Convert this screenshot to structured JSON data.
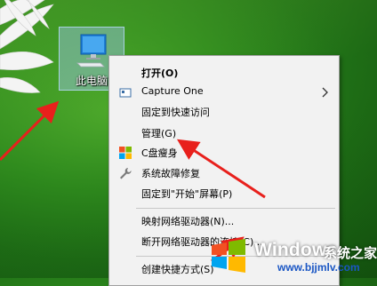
{
  "desktop": {
    "icon_label": "此电脑"
  },
  "context_menu": {
    "items": [
      {
        "label": "打开(O)",
        "bold": true
      },
      {
        "label": "Capture One",
        "has_submenu": true,
        "icon": "capture-one-icon"
      },
      {
        "label": "固定到快速访问"
      },
      {
        "label": "管理(G)"
      },
      {
        "label": "C盘瘦身",
        "icon": "windows-logo-icon"
      },
      {
        "label": "系统故障修复",
        "icon": "wrench-icon"
      },
      {
        "label": "固定到\"开始\"屏幕(P)"
      },
      {
        "label": "映射网络驱动器(N)..."
      },
      {
        "label": "断开网络驱动器的连接(C)..."
      },
      {
        "label": "创建快捷方式(S)"
      }
    ]
  },
  "watermark": {
    "brand": "Windows",
    "brand_cn": "系统之家",
    "url": "www.bjjmlv.com"
  },
  "colors": {
    "arrow": "#e8201c",
    "menu_bg": "#f2f2f2",
    "selection": "#a0c8f0"
  }
}
